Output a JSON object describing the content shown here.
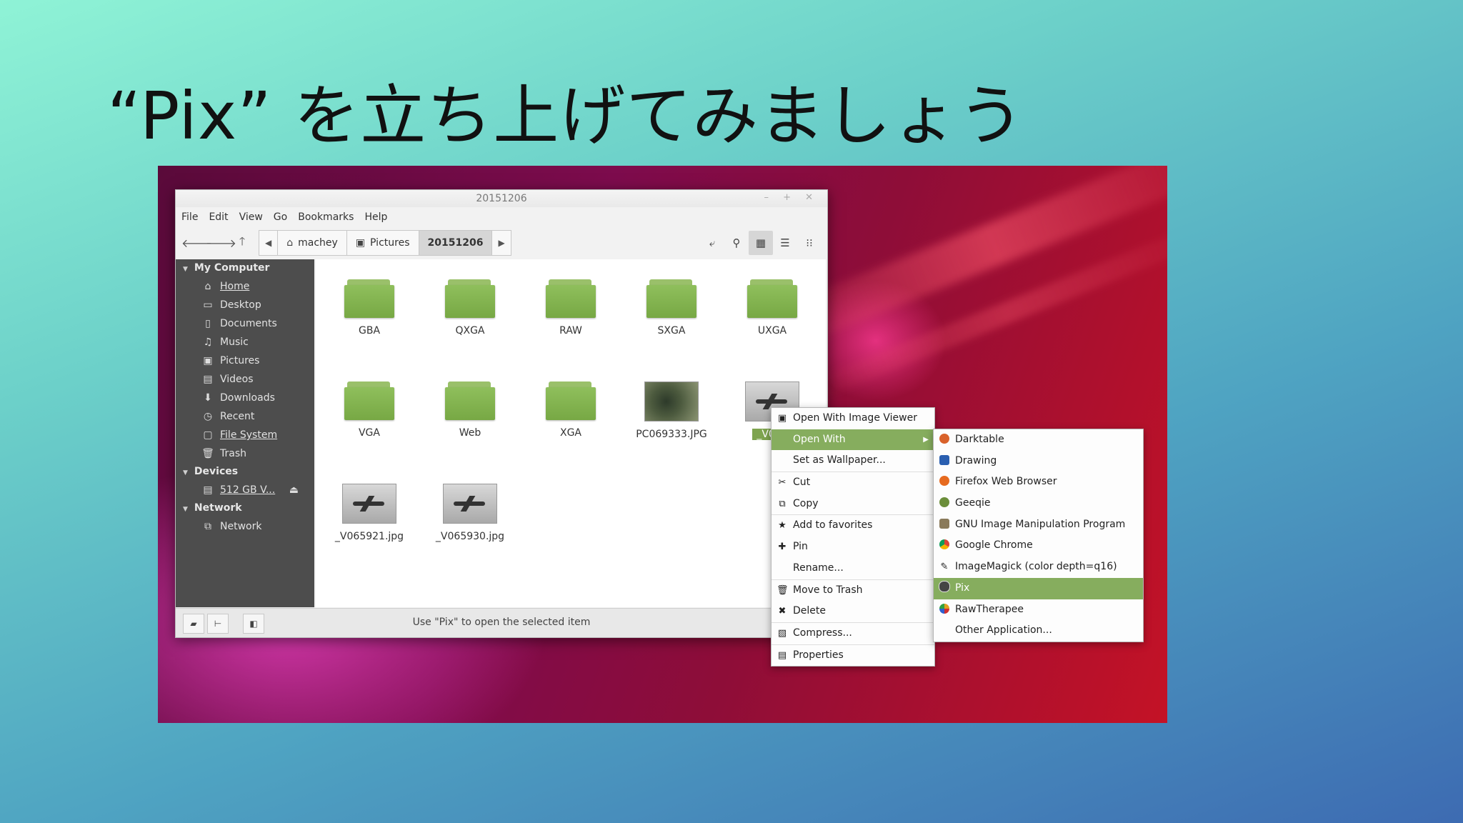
{
  "slide": {
    "title": "“Pix” を立ち上げてみましょう"
  },
  "window": {
    "title": "20151206",
    "menus": [
      "File",
      "Edit",
      "View",
      "Go",
      "Bookmarks",
      "Help"
    ],
    "breadcrumbs": [
      "machey",
      "Pictures",
      "20151206"
    ]
  },
  "sidebar": {
    "sections": [
      {
        "label": "My Computer",
        "items": [
          {
            "label": "Home",
            "icon": "home-icon"
          },
          {
            "label": "Desktop",
            "icon": "desktop-icon"
          },
          {
            "label": "Documents",
            "icon": "documents-icon"
          },
          {
            "label": "Music",
            "icon": "music-icon"
          },
          {
            "label": "Pictures",
            "icon": "pictures-icon"
          },
          {
            "label": "Videos",
            "icon": "videos-icon"
          },
          {
            "label": "Downloads",
            "icon": "downloads-icon"
          },
          {
            "label": "Recent",
            "icon": "recent-icon"
          },
          {
            "label": "File System",
            "icon": "filesystem-icon"
          },
          {
            "label": "Trash",
            "icon": "trash-icon"
          }
        ]
      },
      {
        "label": "Devices",
        "items": [
          {
            "label": "512 GB V...",
            "icon": "drive-icon"
          }
        ]
      },
      {
        "label": "Network",
        "items": [
          {
            "label": "Network",
            "icon": "network-icon"
          }
        ]
      }
    ]
  },
  "files": [
    {
      "name": "GBA",
      "kind": "folder"
    },
    {
      "name": "QXGA",
      "kind": "folder"
    },
    {
      "name": "RAW",
      "kind": "folder"
    },
    {
      "name": "SXGA",
      "kind": "folder"
    },
    {
      "name": "UXGA",
      "kind": "folder"
    },
    {
      "name": "VGA",
      "kind": "folder"
    },
    {
      "name": "Web",
      "kind": "folder"
    },
    {
      "name": "XGA",
      "kind": "folder"
    },
    {
      "name": "PC069333.JPG",
      "kind": "image"
    },
    {
      "name": "_V065",
      "kind": "image"
    },
    {
      "name": "_V065921.jpg",
      "kind": "image"
    },
    {
      "name": "_V065930.jpg",
      "kind": "image"
    }
  ],
  "status": {
    "text": "Use \"Pix\" to open the selected item"
  },
  "context_menu": {
    "items": [
      {
        "label": "Open With Image Viewer",
        "icon": "image-viewer-icon"
      },
      {
        "label": "Open With",
        "icon": "",
        "highlighted": true,
        "submenu": true
      },
      {
        "label": "Set as Wallpaper...",
        "icon": ""
      },
      {
        "label": "Cut",
        "icon": "cut-icon"
      },
      {
        "label": "Copy",
        "icon": "copy-icon"
      },
      {
        "label": "Add to favorites",
        "icon": "star-icon"
      },
      {
        "label": "Pin",
        "icon": "pin-icon"
      },
      {
        "label": "Rename...",
        "icon": ""
      },
      {
        "label": "Move to Trash",
        "icon": "trash-icon"
      },
      {
        "label": "Delete",
        "icon": "delete-icon"
      },
      {
        "label": "Compress...",
        "icon": "compress-icon"
      },
      {
        "label": "Properties",
        "icon": "properties-icon"
      }
    ]
  },
  "open_with_menu": {
    "items": [
      {
        "label": "Darktable",
        "color": "#d9622b"
      },
      {
        "label": "Drawing",
        "color": "#2a5fb0"
      },
      {
        "label": "Firefox Web Browser",
        "color": "#e66a1f"
      },
      {
        "label": "Geeqie",
        "color": "#6b8e3a"
      },
      {
        "label": "GNU Image Manipulation Program",
        "color": "#8a7a5a"
      },
      {
        "label": "Google Chrome",
        "color": "#db4437"
      },
      {
        "label": "ImageMagick (color depth=q16)",
        "color": "#aaaaaa"
      },
      {
        "label": "Pix",
        "color": "#444444",
        "highlighted": true
      },
      {
        "label": "RawTherapee",
        "color": "#e0a020"
      },
      {
        "label": "Other Application...",
        "color": ""
      }
    ]
  }
}
